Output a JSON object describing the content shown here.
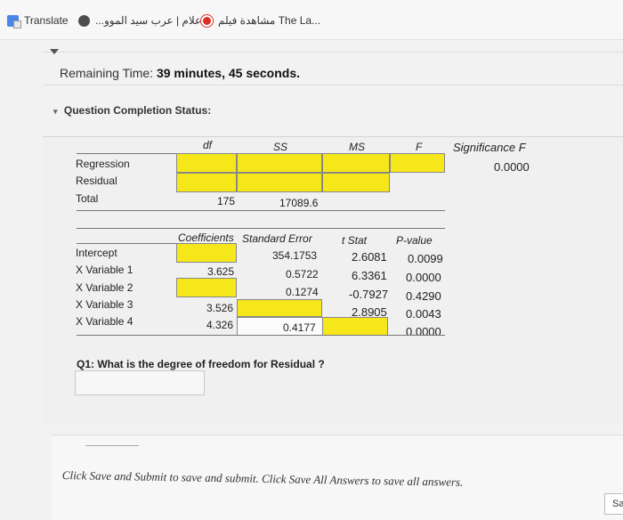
{
  "bookmarks": {
    "translate": "Translate",
    "news": "اعلام | عرب سيد الموو...",
    "video": "مشاهدة فيلم The La..."
  },
  "exam": {
    "remaining_label": "Remaining Time:",
    "remaining_value": "39 minutes, 45 seconds.",
    "status_label": "Question Completion Status:"
  },
  "anova": {
    "headers": [
      "df",
      "SS",
      "MS",
      "F",
      "Significance F"
    ],
    "rows": [
      "Regression",
      "Residual",
      "Total"
    ],
    "significance_f": "0.0000",
    "total_df": "175",
    "total_ss": "17089.6"
  },
  "coef": {
    "headers": [
      "Coefficients",
      "Standard Error",
      "t Stat",
      "P-value"
    ],
    "rows": [
      {
        "name": "Intercept",
        "coef": "",
        "se": "354.1753",
        "t": "2.6081",
        "p": "0.0099"
      },
      {
        "name": "X Variable 1",
        "coef": "3.625",
        "se": "0.5722",
        "t": "6.3361",
        "p": "0.0000"
      },
      {
        "name": "X Variable 2",
        "coef": "",
        "se": "0.1274",
        "t": "-0.7927",
        "p": "0.4290"
      },
      {
        "name": "X Variable 3",
        "coef": "3.526",
        "se": "",
        "t": "2.8905",
        "p": "0.0043"
      },
      {
        "name": "X Variable 4",
        "coef": "4.326",
        "se": "0.4177",
        "t": "",
        "p": "0.0000"
      }
    ]
  },
  "question": {
    "text": "Q1: What is the degree of freedom for Residual ?",
    "answer": ""
  },
  "footer": {
    "text": "Click Save and Submit to save and submit. Click Save All Answers to save all answers.",
    "save_button": "Sa"
  }
}
